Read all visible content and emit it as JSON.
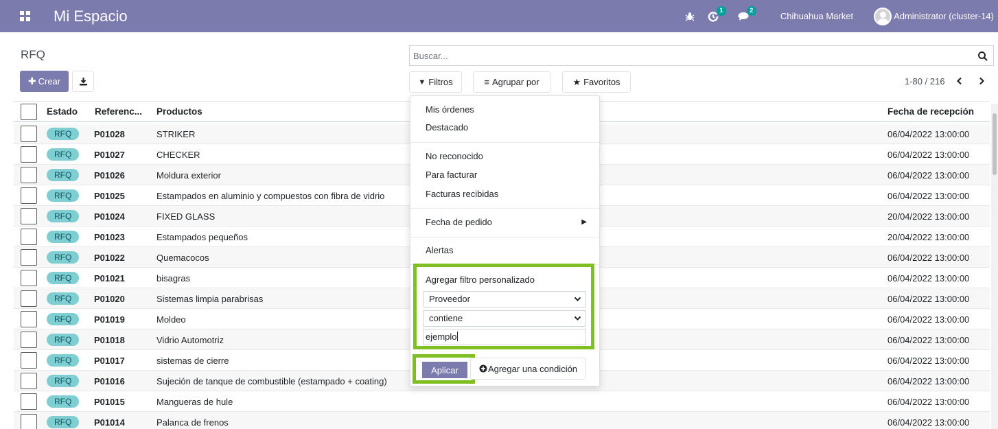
{
  "navbar": {
    "title": "Mi Espacio",
    "activity_count": "1",
    "messages_count": "2",
    "company": "Chihuahua Market",
    "user": "Administrator (cluster-14)"
  },
  "control": {
    "breadcrumb": "RFQ",
    "create_label": "Crear",
    "search_placeholder": "Buscar...",
    "filters_label": "Filtros",
    "group_label": "Agrupar por",
    "favorites_label": "Favoritos",
    "pager": "1-80 / 216"
  },
  "table": {
    "headers": [
      "Estado",
      "Referenc...",
      "Productos",
      "Fecha de recepción"
    ],
    "rows": [
      {
        "status": "RFQ",
        "ref": "P01028",
        "product": "STRIKER",
        "date": "06/04/2022 13:00:00"
      },
      {
        "status": "RFQ",
        "ref": "P01027",
        "product": "CHECKER",
        "date": "06/04/2022 13:00:00"
      },
      {
        "status": "RFQ",
        "ref": "P01026",
        "product": "Moldura exterior",
        "date": "06/04/2022 13:00:00"
      },
      {
        "status": "RFQ",
        "ref": "P01025",
        "product": "Estampados en aluminio y compuestos con fibra de vidrio",
        "date": "06/04/2022 13:00:00"
      },
      {
        "status": "RFQ",
        "ref": "P01024",
        "product": "FIXED GLASS",
        "date": "20/04/2022 13:00:00"
      },
      {
        "status": "RFQ",
        "ref": "P01023",
        "product": "Estampados pequeños",
        "date": "20/04/2022 13:00:00"
      },
      {
        "status": "RFQ",
        "ref": "P01022",
        "product": "Quemacocos",
        "date": "06/04/2022 13:00:00"
      },
      {
        "status": "RFQ",
        "ref": "P01021",
        "product": "bisagras",
        "date": "06/04/2022 13:00:00"
      },
      {
        "status": "RFQ",
        "ref": "P01020",
        "product": "Sistemas limpia parabrisas",
        "date": "06/04/2022 13:00:00"
      },
      {
        "status": "RFQ",
        "ref": "P01019",
        "product": "Moldeo",
        "date": "06/04/2022 13:00:00"
      },
      {
        "status": "RFQ",
        "ref": "P01018",
        "product": "Vidrio Automotriz",
        "date": "06/04/2022 13:00:00"
      },
      {
        "status": "RFQ",
        "ref": "P01017",
        "product": "sistemas de cierre",
        "date": "06/04/2022 13:00:00"
      },
      {
        "status": "RFQ",
        "ref": "P01016",
        "product": "Sujeción de tanque de combustible (estampado + coating)",
        "date": "06/04/2022 13:00:00"
      },
      {
        "status": "RFQ",
        "ref": "P01015",
        "product": "Mangueras de hule",
        "date": "06/04/2022 13:00:00"
      },
      {
        "status": "RFQ",
        "ref": "P01014",
        "product": "Palanca de frenos",
        "date": "06/04/2022 13:00:00"
      }
    ]
  },
  "dropdown": {
    "group1": [
      "Mis órdenes",
      "Destacado"
    ],
    "group2": [
      "No reconocido",
      "Para facturar",
      "Facturas recibidas"
    ],
    "date_filter": "Fecha de pedido",
    "alerts": "Alertas",
    "custom_filter_label": "Agregar filtro personalizado",
    "field_select": "Proveedor",
    "operator_select": "contiene",
    "value_input": "ejemplo",
    "apply_label": "Aplicar",
    "add_condition_label": "Agregar una condición"
  },
  "colors": {
    "brand": "#7c7bad",
    "badge": "#7fcfd2",
    "highlight": "#7fbf21"
  }
}
